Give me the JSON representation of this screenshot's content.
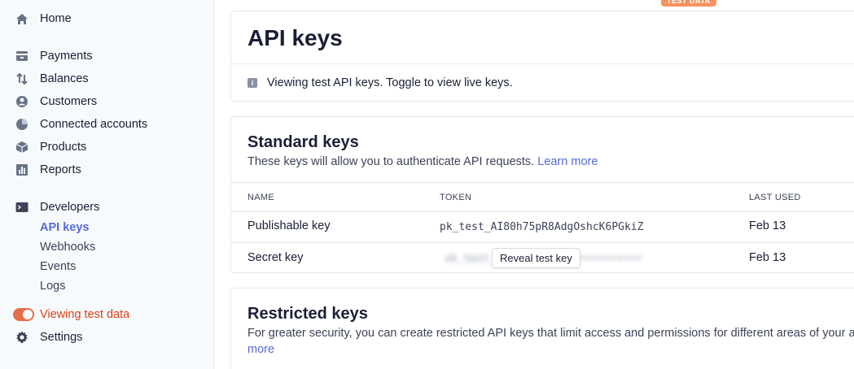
{
  "sidebar": {
    "home": "Home",
    "payments": "Payments",
    "balances": "Balances",
    "customers": "Customers",
    "connected_accounts": "Connected accounts",
    "products": "Products",
    "reports": "Reports",
    "developers": "Developers",
    "developers_sub": {
      "api_keys": "API keys",
      "webhooks": "Webhooks",
      "events": "Events",
      "logs": "Logs"
    },
    "test_toggle_label": "Viewing test data",
    "settings": "Settings"
  },
  "badge": "TEST DATA",
  "page_title": "API keys",
  "notice": "Viewing test API keys. Toggle to view live keys.",
  "standard_keys": {
    "title": "Standard keys",
    "description": "These keys will allow you to authenticate API requests.",
    "learn_more": "Learn more",
    "columns": {
      "name": "NAME",
      "token": "TOKEN",
      "last_used": "LAST USED"
    },
    "rows": [
      {
        "name": "Publishable key",
        "token": "pk_test_AI80h75pR8AdgOshcK6PGkiZ",
        "last_used": "Feb 13"
      },
      {
        "name": "Secret key",
        "token": "sk_test_•••••••••••••••••••••••",
        "last_used": "Feb 13"
      }
    ],
    "reveal_button": "Reveal test key"
  },
  "restricted_keys": {
    "title": "Restricted keys",
    "description": "For greater security, you can create restricted API keys that limit access and permissions for different areas of your a",
    "more_link": "more"
  },
  "colors": {
    "accent": "#5469d4",
    "test_orange": "#e56f4a",
    "badge": "#f5925e"
  }
}
